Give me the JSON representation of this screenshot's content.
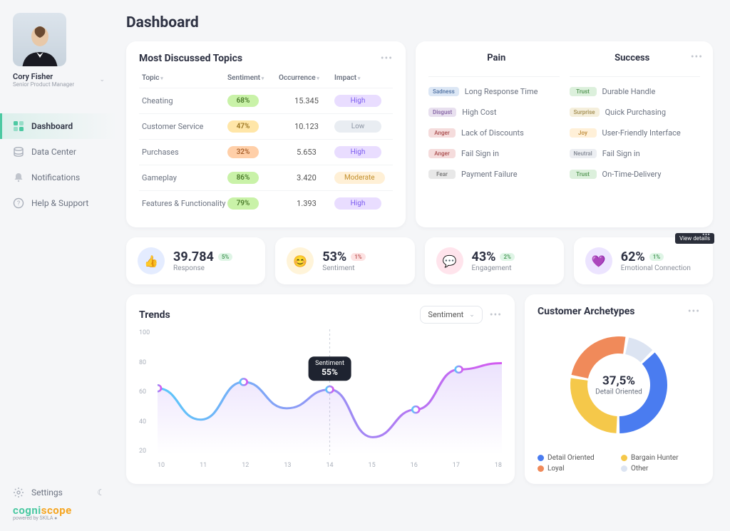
{
  "profile": {
    "name": "Cory Fisher",
    "role": "Senior Product Manager"
  },
  "nav": {
    "items": [
      {
        "label": "Dashboard",
        "active": true
      },
      {
        "label": "Data Center",
        "active": false
      },
      {
        "label": "Notifications",
        "active": false
      },
      {
        "label": "Help & Support",
        "active": false
      }
    ],
    "settings_label": "Settings"
  },
  "logo": {
    "part1": "cogni",
    "part2": "scope",
    "sub": "powered by SKILA ●"
  },
  "page": {
    "title": "Dashboard"
  },
  "topics": {
    "title": "Most Discussed Topics",
    "cols": {
      "topic": "Topic",
      "sentiment": "Sentiment",
      "occurrence": "Occurrence",
      "impact": "Impact"
    },
    "rows": [
      {
        "topic": "Cheating",
        "sentiment": "68%",
        "sent_class": "sent-green",
        "occurrence": "15.345",
        "impact": "High",
        "impact_class": "impact-high"
      },
      {
        "topic": "Customer Service",
        "sentiment": "47%",
        "sent_class": "sent-yellow",
        "occurrence": "10.123",
        "impact": "Low",
        "impact_class": "impact-low"
      },
      {
        "topic": "Purchases",
        "sentiment": "32%",
        "sent_class": "sent-orange",
        "occurrence": "5.653",
        "impact": "High",
        "impact_class": "impact-high"
      },
      {
        "topic": "Gameplay",
        "sentiment": "86%",
        "sent_class": "sent-green",
        "occurrence": "3.420",
        "impact": "Moderate",
        "impact_class": "impact-mod"
      },
      {
        "topic": "Features & Functionality",
        "sentiment": "79%",
        "sent_class": "sent-green",
        "occurrence": "1.393",
        "impact": "High",
        "impact_class": "impact-high"
      }
    ]
  },
  "pain_success": {
    "tab_pain": "Pain",
    "tab_success": "Success",
    "pain": [
      {
        "emo": "Sadness",
        "emo_class": "emo-sadness",
        "text": "Long Response Time"
      },
      {
        "emo": "Disgust",
        "emo_class": "emo-disgust",
        "text": "High Cost"
      },
      {
        "emo": "Anger",
        "emo_class": "emo-anger",
        "text": "Lack of Discounts"
      },
      {
        "emo": "Anger",
        "emo_class": "emo-anger",
        "text": "Fail Sign in"
      },
      {
        "emo": "Fear",
        "emo_class": "emo-fear",
        "text": "Payment Failure"
      }
    ],
    "success": [
      {
        "emo": "Trust",
        "emo_class": "emo-trust",
        "text": "Durable Handle"
      },
      {
        "emo": "Surprise",
        "emo_class": "emo-surprise",
        "text": "Quick Purchasing"
      },
      {
        "emo": "Joy",
        "emo_class": "emo-joy",
        "text": "User-Friendly Interface"
      },
      {
        "emo": "Neutral",
        "emo_class": "emo-neutral",
        "text": "Fail Sign in"
      },
      {
        "emo": "Trust",
        "emo_class": "emo-trust",
        "text": "On-Time-Delivery"
      }
    ]
  },
  "kpis": [
    {
      "value": "39.784",
      "label": "Response",
      "delta": "5%",
      "delta_class": "",
      "icon_class": "blue",
      "icon": "👍"
    },
    {
      "value": "53%",
      "label": "Sentiment",
      "delta": "1%",
      "delta_class": "red",
      "icon_class": "yellow",
      "icon": "😊"
    },
    {
      "value": "43%",
      "label": "Engagement",
      "delta": "2%",
      "delta_class": "",
      "icon_class": "pink",
      "icon": "💬"
    },
    {
      "value": "62%",
      "label": "Emotional Connection",
      "delta": "1%",
      "delta_class": "",
      "icon_class": "purple",
      "icon": "💜"
    }
  ],
  "kpi_tooltip": "View details",
  "trends": {
    "title": "Trends",
    "dropdown": "Sentiment",
    "tooltip_label": "Sentiment",
    "tooltip_value": "55%"
  },
  "archetypes": {
    "title": "Customer Archetypes",
    "center_value": "37,5%",
    "center_label": "Detail Oriented",
    "legend": [
      {
        "label": "Detail Oriented",
        "color": "#4a7cf0"
      },
      {
        "label": "Bargain Hunter",
        "color": "#f5c84a"
      },
      {
        "label": "Loyal",
        "color": "#f08a5a"
      },
      {
        "label": "Other",
        "color": "#dce4f2"
      }
    ]
  },
  "chart_data": [
    {
      "type": "line",
      "title": "Trends",
      "xlabel": "",
      "ylabel": "",
      "x": [
        10,
        11,
        12,
        13,
        14,
        15,
        16,
        17,
        18
      ],
      "series": [
        {
          "name": "Sentiment",
          "values": [
            53,
            28,
            58,
            37,
            52,
            14,
            36,
            68,
            73
          ],
          "color_gradient": [
            "#5ac8fa",
            "#d45af0"
          ]
        }
      ],
      "ylim": [
        0,
        100
      ],
      "y_ticks": [
        20,
        40,
        60,
        80,
        100
      ],
      "highlight": {
        "x": 14,
        "y": 55,
        "label": "Sentiment 55%"
      }
    },
    {
      "type": "pie",
      "title": "Customer Archetypes",
      "series": [
        {
          "name": "Detail Oriented",
          "value": 37.5,
          "color": "#4a7cf0"
        },
        {
          "name": "Bargain Hunter",
          "value": 27.5,
          "color": "#f5c84a"
        },
        {
          "name": "Loyal",
          "value": 25.0,
          "color": "#f08a5a"
        },
        {
          "name": "Other",
          "value": 10.0,
          "color": "#dce4f2"
        }
      ],
      "center_label": "37,5% Detail Oriented"
    }
  ]
}
